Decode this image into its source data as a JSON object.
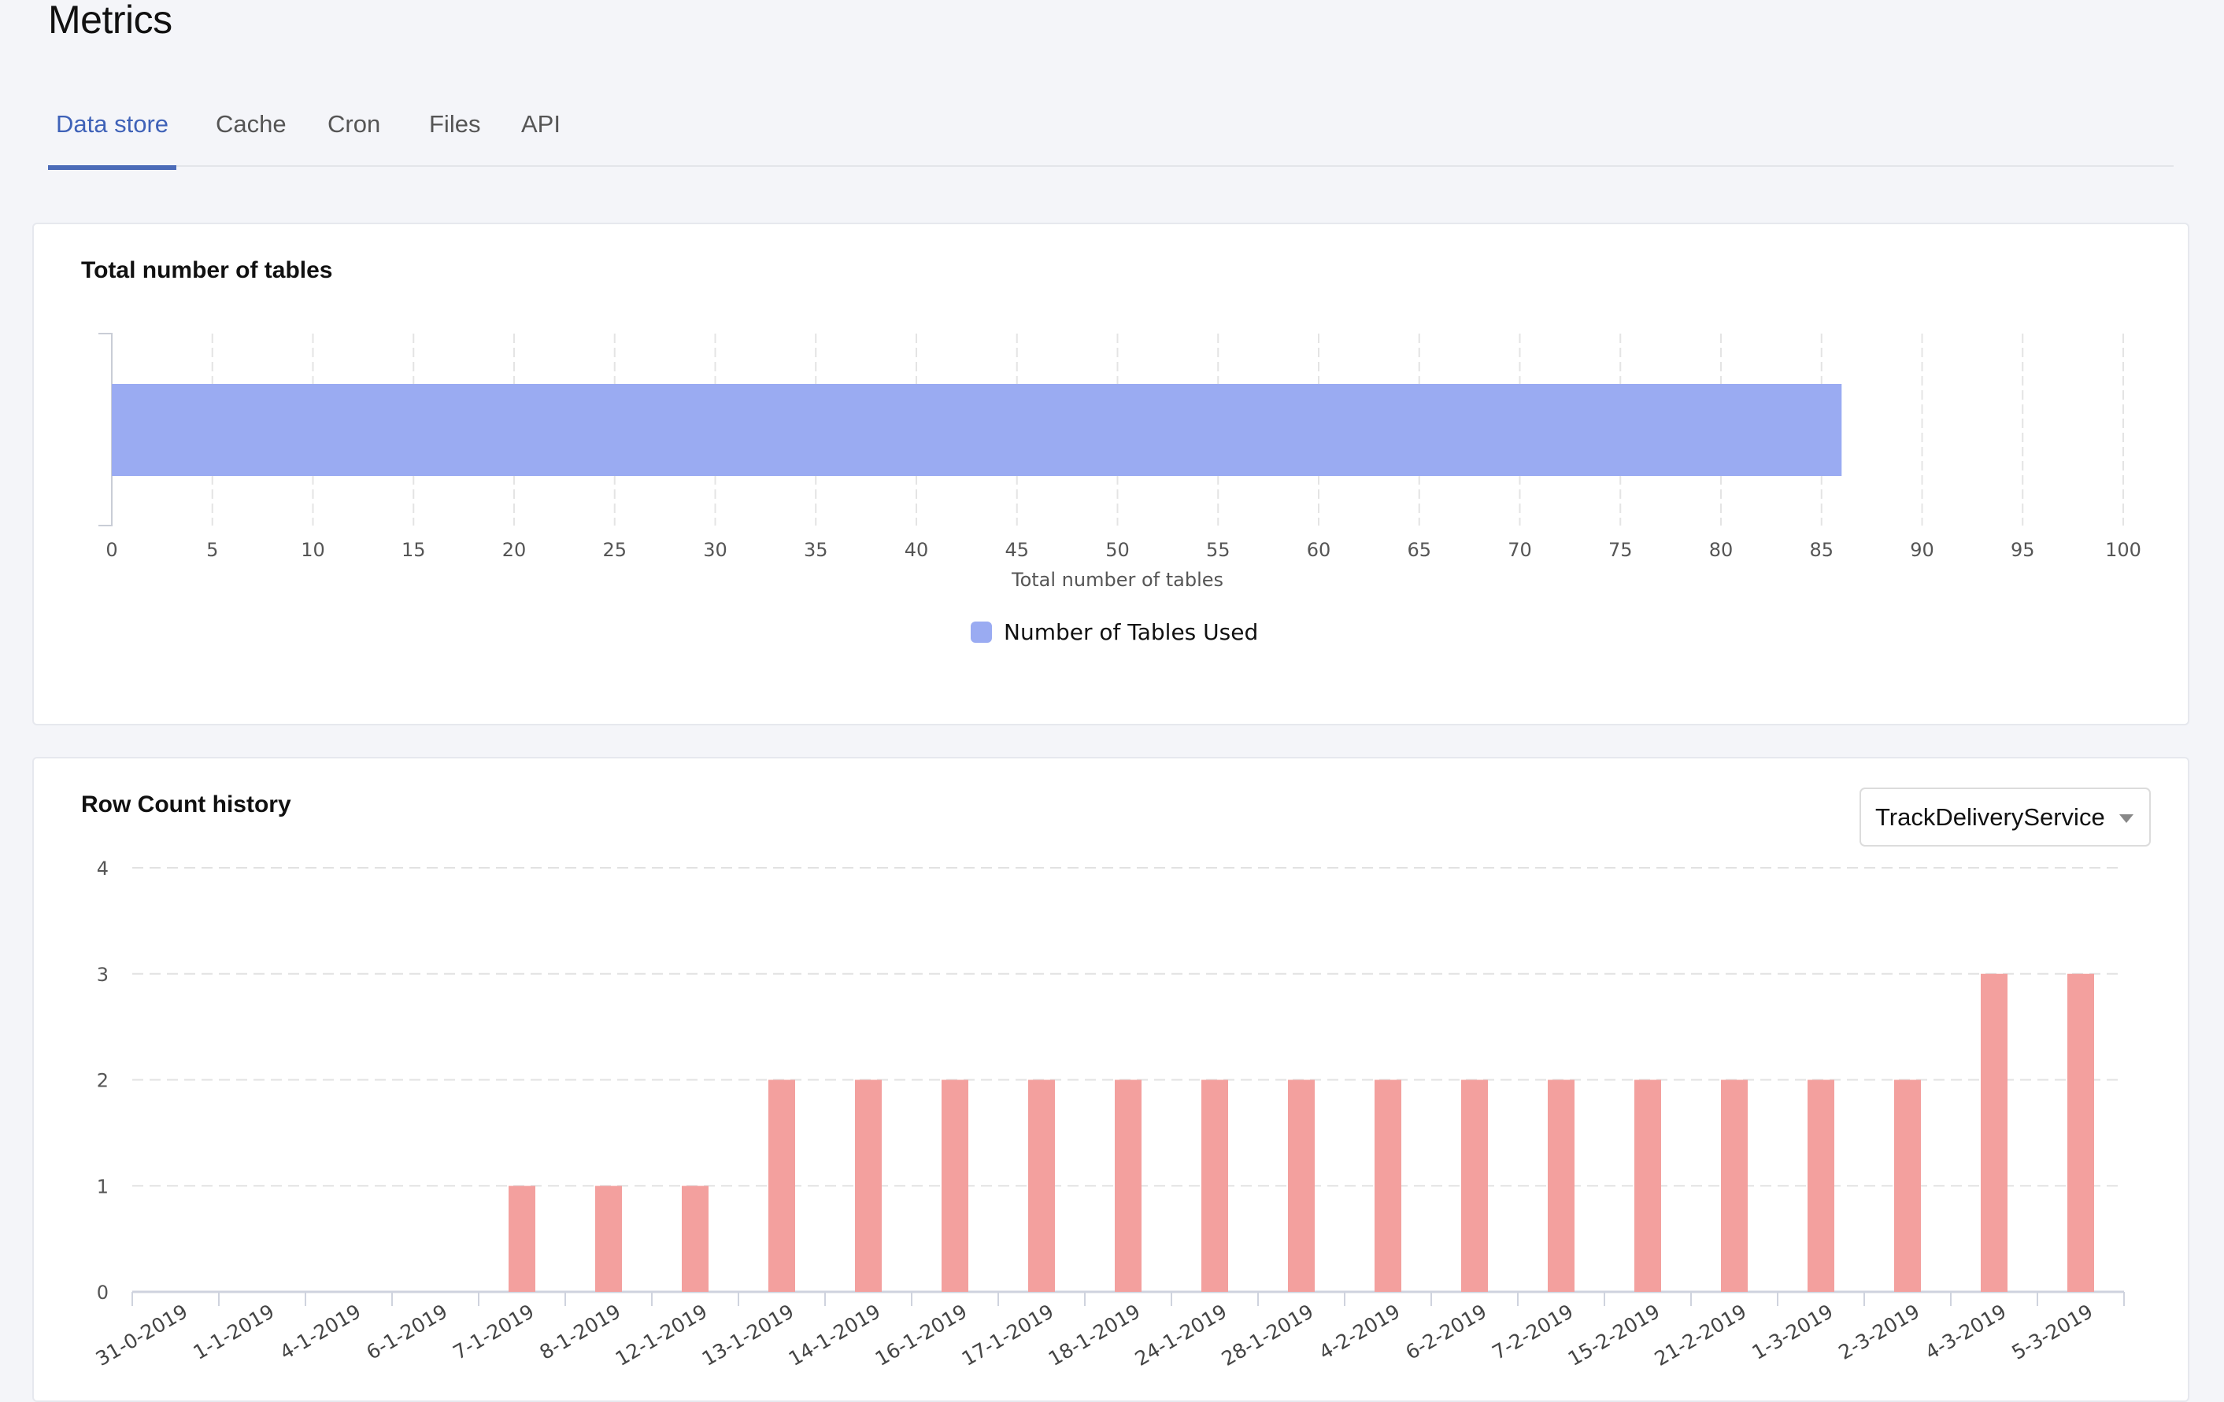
{
  "page": {
    "title": "Metrics"
  },
  "tabs": [
    {
      "label": "Data store",
      "active": true
    },
    {
      "label": "Cache",
      "active": false
    },
    {
      "label": "Cron",
      "active": false
    },
    {
      "label": "Files",
      "active": false
    },
    {
      "label": "API",
      "active": false
    }
  ],
  "tables_card": {
    "title": "Total number of tables"
  },
  "row_count_card": {
    "title": "Row Count history",
    "service_select": {
      "value": "TrackDeliveryService"
    }
  },
  "colors": {
    "tables_bar": "#9aabf2",
    "row_bar": "#f3a09e",
    "active_tab": "#3f62b8"
  },
  "chart_data": [
    {
      "type": "bar",
      "orientation": "horizontal",
      "title": "Total number of tables",
      "categories": [
        ""
      ],
      "series": [
        {
          "name": "Number of Tables Used",
          "values": [
            86
          ]
        }
      ],
      "xlabel": "Total number of tables",
      "ylabel": "",
      "xlim": [
        0,
        100
      ],
      "xticks": [
        0,
        5,
        10,
        15,
        20,
        25,
        30,
        35,
        40,
        45,
        50,
        55,
        60,
        65,
        70,
        75,
        80,
        85,
        90,
        95,
        100
      ],
      "grid": "vertical dashed",
      "legend": "bottom-center"
    },
    {
      "type": "bar",
      "orientation": "vertical",
      "title": "Row Count history",
      "categories": [
        "31-0-2019",
        "1-1-2019",
        "4-1-2019",
        "6-1-2019",
        "7-1-2019",
        "8-1-2019",
        "12-1-2019",
        "13-1-2019",
        "14-1-2019",
        "16-1-2019",
        "17-1-2019",
        "18-1-2019",
        "24-1-2019",
        "28-1-2019",
        "4-2-2019",
        "6-2-2019",
        "7-2-2019",
        "15-2-2019",
        "21-2-2019",
        "1-3-2019",
        "2-3-2019",
        "4-3-2019",
        "5-3-2019"
      ],
      "series": [
        {
          "name": "Row Count",
          "values": [
            0,
            0,
            0,
            0,
            1,
            1,
            1,
            2,
            2,
            2,
            2,
            2,
            2,
            2,
            2,
            2,
            2,
            2,
            2,
            2,
            2,
            3,
            3
          ]
        }
      ],
      "xlabel": "",
      "ylabel": "",
      "ylim": [
        0,
        4
      ],
      "yticks": [
        0,
        1,
        2,
        3,
        4
      ],
      "grid": "horizontal dashed",
      "legend": "none"
    }
  ]
}
